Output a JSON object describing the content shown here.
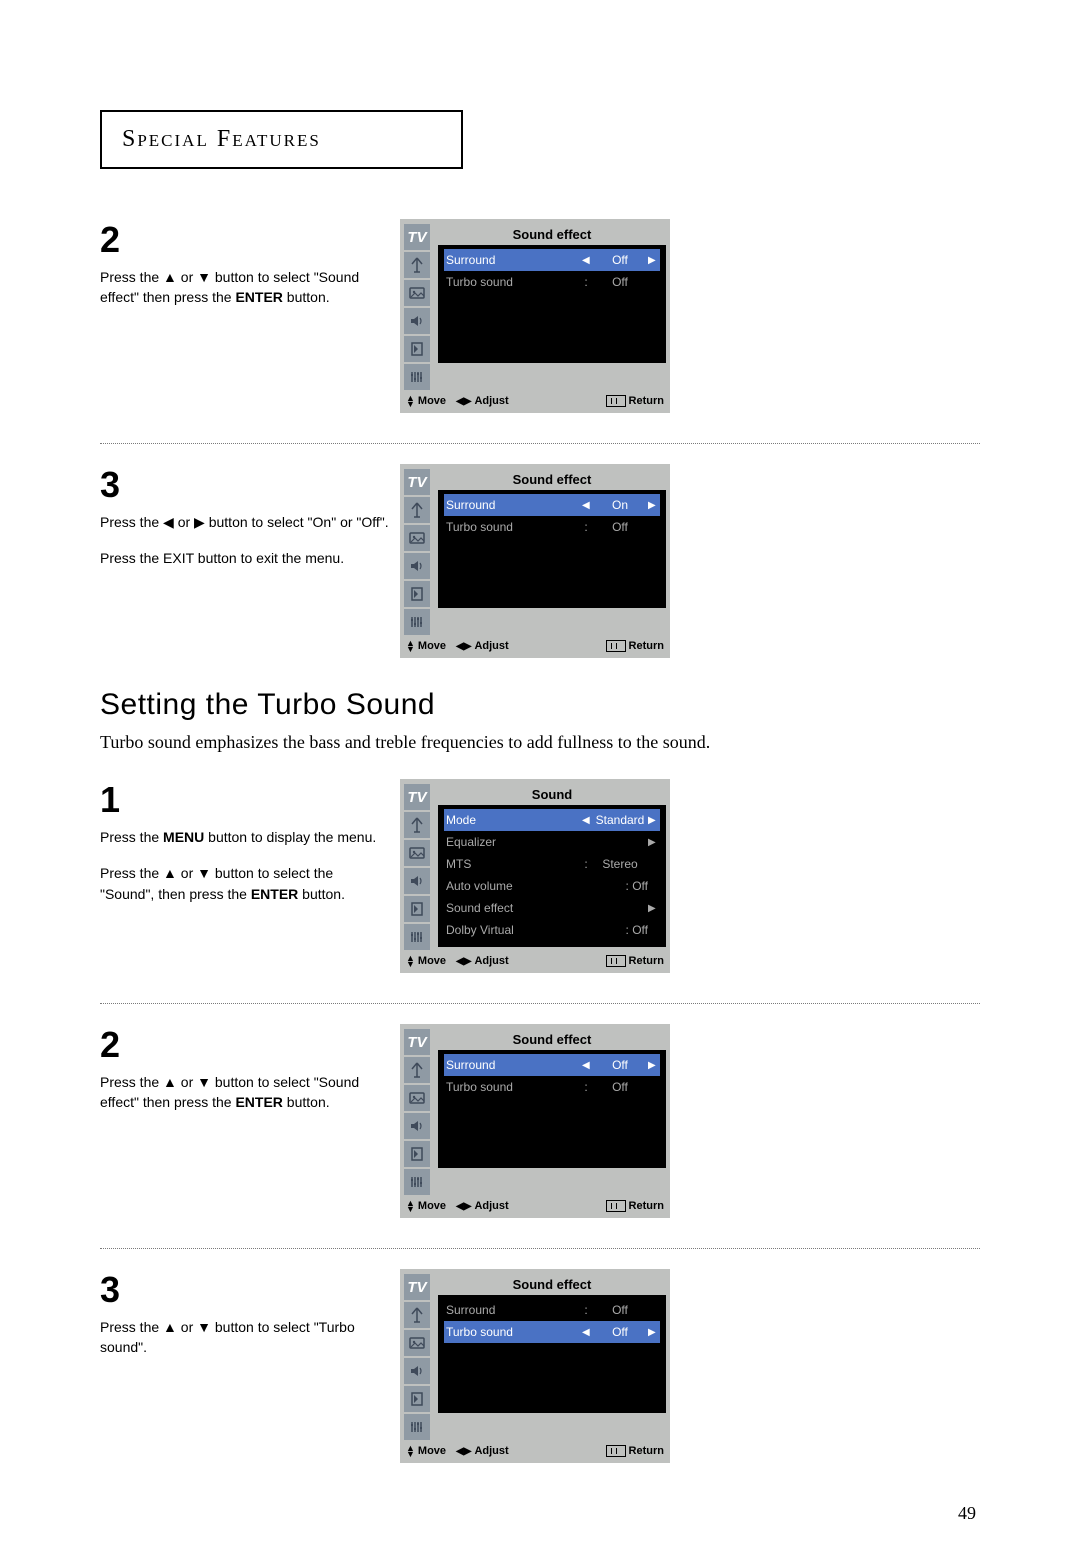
{
  "section_title": "Special Features",
  "page_number": "49",
  "subheading": "Setting the Turbo Sound",
  "subdesc": "Turbo sound emphasizes the bass and treble frequencies to add fullness to the sound.",
  "arrows": {
    "up": "▲",
    "down": "▼",
    "left": "◀",
    "right": "▶"
  },
  "footer": {
    "move": "Move",
    "adjust": "Adjust",
    "return": "Return"
  },
  "tv_label": "TV",
  "steps_top": [
    {
      "num": "2",
      "text_parts": [
        "Press the ",
        "▲",
        " or ",
        "▼",
        " button to select \"Sound effect\" then press the ",
        "ENTER",
        " button."
      ],
      "menu": {
        "title": "Sound effect",
        "rows": [
          {
            "label": "Surround",
            "value": "Off",
            "selected": true,
            "adjustable": true
          },
          {
            "label": "Turbo sound",
            "value": "Off",
            "selected": false,
            "adjustable": false
          }
        ]
      }
    },
    {
      "num": "3",
      "text_parts": [
        "Press the ",
        "◀",
        " or ",
        "▶",
        " button to select \"On\" or \"Off\"."
      ],
      "text2": "Press the EXIT button to exit the menu.",
      "menu": {
        "title": "Sound effect",
        "rows": [
          {
            "label": "Surround",
            "value": "On",
            "selected": true,
            "adjustable": true
          },
          {
            "label": "Turbo sound",
            "value": "Off",
            "selected": false,
            "adjustable": false
          }
        ]
      }
    }
  ],
  "steps_bottom": [
    {
      "num": "1",
      "text_parts": [
        "Press the ",
        "MENU",
        " button to display the menu."
      ],
      "text2_parts": [
        "Press the ",
        "▲",
        " or ",
        "▼",
        " button to select the \"Sound\", then press the ",
        "ENTER",
        " button."
      ],
      "menu": {
        "title": "Sound",
        "rows": [
          {
            "label": "Mode",
            "value": "Standard",
            "selected": true,
            "adjustable": true
          },
          {
            "label": "Equalizer",
            "value": "",
            "selected": false,
            "adjustable": false,
            "chevron": true
          },
          {
            "label": "MTS",
            "value": "Stereo",
            "selected": false,
            "adjustable": false
          },
          {
            "label": "Auto volume",
            "value": ": Off",
            "selected": false,
            "adjustable": false,
            "raw": true
          },
          {
            "label": "Sound effect",
            "value": "",
            "selected": false,
            "adjustable": false,
            "chevron": true
          },
          {
            "label": "Dolby Virtual",
            "value": ": Off",
            "selected": false,
            "adjustable": false,
            "raw": true
          }
        ]
      }
    },
    {
      "num": "2",
      "text_parts": [
        "Press the ",
        "▲",
        " or ",
        "▼",
        " button to select \"Sound effect\" then press the ",
        "ENTER",
        " button."
      ],
      "menu": {
        "title": "Sound effect",
        "rows": [
          {
            "label": "Surround",
            "value": "Off",
            "selected": true,
            "adjustable": true
          },
          {
            "label": "Turbo sound",
            "value": "Off",
            "selected": false,
            "adjustable": false
          }
        ]
      }
    },
    {
      "num": "3",
      "text_parts": [
        "Press the ",
        "▲",
        " or ",
        "▼",
        " button to select \"Turbo sound\"."
      ],
      "menu": {
        "title": "Sound effect",
        "rows": [
          {
            "label": "Surround",
            "value": "Off",
            "selected": false,
            "adjustable": false
          },
          {
            "label": "Turbo sound",
            "value": "Off",
            "selected": true,
            "adjustable": true
          }
        ]
      }
    }
  ]
}
